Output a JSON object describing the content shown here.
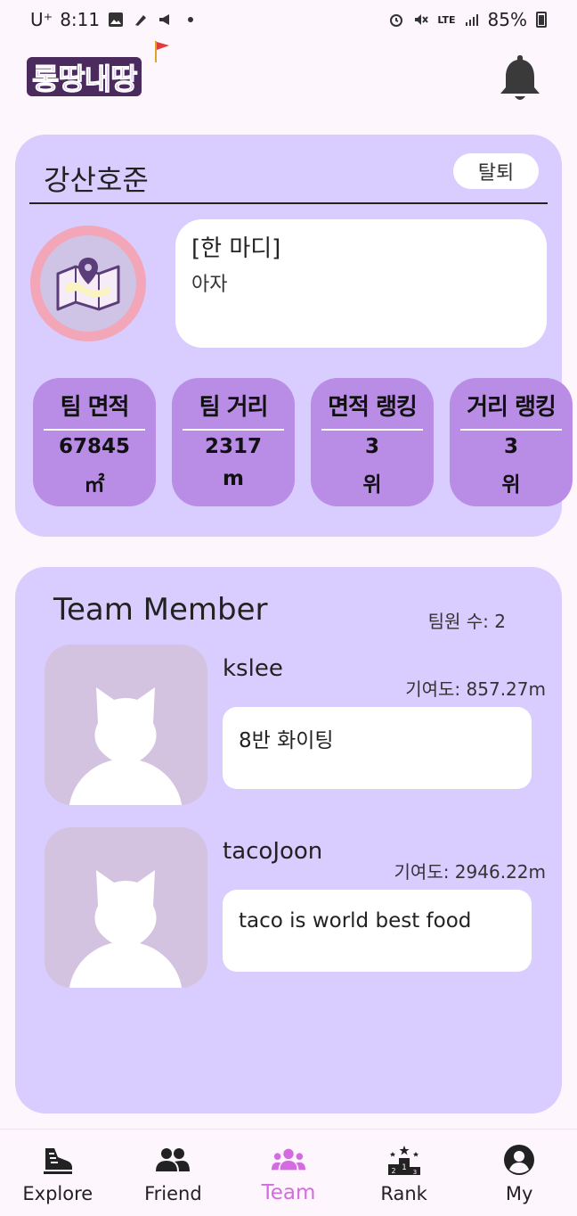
{
  "status_bar": {
    "carrier": "U⁺",
    "time": "8:11",
    "network": "LTE",
    "battery": "85%"
  },
  "header": {
    "logo_text": "롱땅내땅",
    "icons": [
      "bell-icon"
    ]
  },
  "team": {
    "name": "강산호준",
    "leave_label": "탈퇴",
    "motto_title": "[한 마디]",
    "motto_text": "아자",
    "stats": [
      {
        "label": "팀 면적",
        "value": "67845",
        "unit": "㎡"
      },
      {
        "label": "팀 거리",
        "value": "2317",
        "unit": "m"
      },
      {
        "label": "면적 랭킹",
        "value": "3",
        "unit": "위"
      },
      {
        "label": "거리 랭킹",
        "value": "3",
        "unit": "위"
      }
    ]
  },
  "members": {
    "title": "Team Member",
    "count_label": "팀원 수: 2",
    "list": [
      {
        "name": "kslee",
        "contribution": "기여도: 857.27m",
        "message": "8반 화이팅"
      },
      {
        "name": "tacoJoon",
        "contribution": "기여도: 2946.22m",
        "message": "taco is world best food"
      }
    ]
  },
  "nav": {
    "items": [
      {
        "label": "Explore",
        "icon": "sneaker-icon"
      },
      {
        "label": "Friend",
        "icon": "people-icon"
      },
      {
        "label": "Team",
        "icon": "team-icon",
        "active": true
      },
      {
        "label": "Rank",
        "icon": "podium-icon"
      },
      {
        "label": "My",
        "icon": "account-icon"
      }
    ],
    "active_color": "#d56be0"
  },
  "colors": {
    "card": "#d9ccff",
    "stat": "#b98de6",
    "avatar_ring": "#f2a6b7"
  }
}
